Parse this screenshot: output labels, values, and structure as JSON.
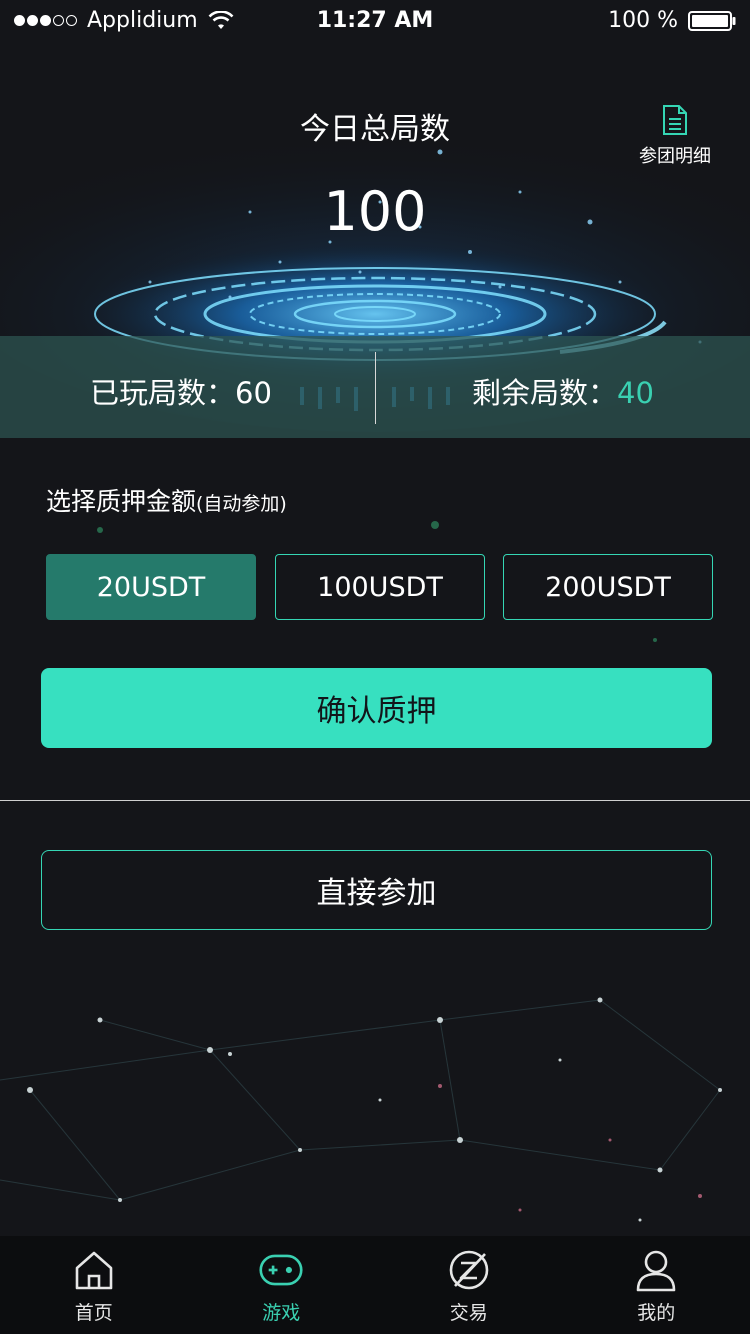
{
  "status_bar": {
    "carrier": "Applidium",
    "time": "11:27 AM",
    "battery": "100 %"
  },
  "hero": {
    "title": "今日总局数",
    "total_games": "100",
    "detail_link": "参团明细",
    "played_label": "已玩局数：",
    "played_value": "60",
    "remaining_label": "剩余局数：",
    "remaining_value": "40"
  },
  "stake": {
    "title": "选择质押金额",
    "title_note": "(自动参加)",
    "options": [
      "20USDT",
      "100USDT",
      "200USDT"
    ],
    "selected": "20USDT",
    "confirm_label": "确认质押"
  },
  "join": {
    "label": "直接参加"
  },
  "tab_bar": {
    "items": [
      {
        "label": "首页",
        "icon": "home-icon"
      },
      {
        "label": "游戏",
        "icon": "gamepad-icon"
      },
      {
        "label": "交易",
        "icon": "trade-icon"
      },
      {
        "label": "我的",
        "icon": "user-icon"
      }
    ],
    "active": "游戏"
  },
  "colors": {
    "accent": "#37e0c0",
    "selected_fill": "#257a6b",
    "background": "#141519"
  }
}
